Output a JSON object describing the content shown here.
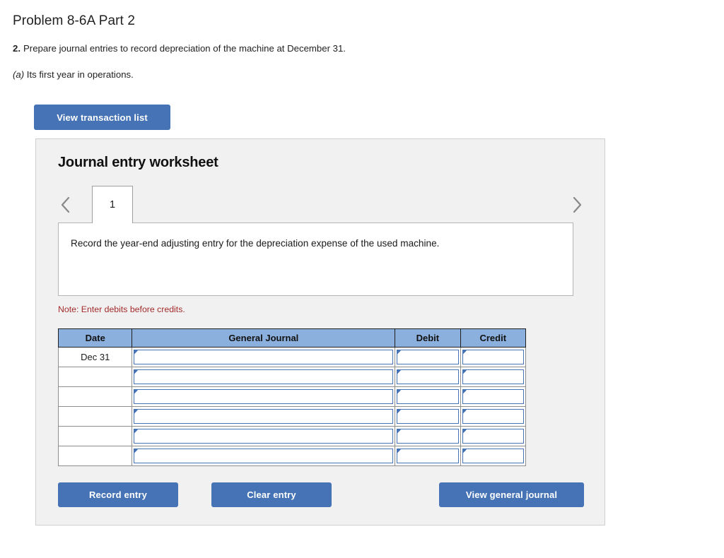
{
  "page": {
    "title": "Problem 8-6A Part 2",
    "question_number": "2.",
    "question_text": "Prepare journal entries to record depreciation of the machine at December 31.",
    "subquestion_letter": "(a)",
    "subquestion_text": "Its first year in operations."
  },
  "toolbar": {
    "view_transaction_list_label": "View transaction list"
  },
  "worksheet": {
    "heading": "Journal entry worksheet",
    "tabs": [
      {
        "label": "1",
        "active": true
      }
    ],
    "prev_icon": "chevron-left-icon",
    "next_icon": "chevron-right-icon",
    "description": "Record the year-end adjusting entry for the depreciation expense of the used machine.",
    "note": "Note: Enter debits before credits."
  },
  "table": {
    "columns": [
      "Date",
      "General Journal",
      "Debit",
      "Credit"
    ],
    "rows": [
      {
        "date": "Dec 31",
        "general_journal": "",
        "debit": "",
        "credit": ""
      },
      {
        "date": "",
        "general_journal": "",
        "debit": "",
        "credit": ""
      },
      {
        "date": "",
        "general_journal": "",
        "debit": "",
        "credit": ""
      },
      {
        "date": "",
        "general_journal": "",
        "debit": "",
        "credit": ""
      },
      {
        "date": "",
        "general_journal": "",
        "debit": "",
        "credit": ""
      },
      {
        "date": "",
        "general_journal": "",
        "debit": "",
        "credit": ""
      }
    ]
  },
  "footer": {
    "record_entry_label": "Record entry",
    "clear_entry_label": "Clear entry",
    "view_general_journal_label": "View general journal"
  },
  "colors": {
    "accent_blue": "#4573b5",
    "header_blue": "#8cb0dd",
    "panel_bg": "#f1f1f1",
    "note_red": "#a32b2b"
  }
}
